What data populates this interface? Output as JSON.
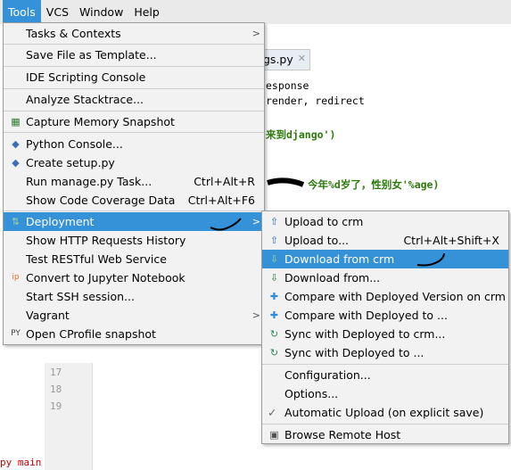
{
  "menubar": {
    "items": [
      "Tools",
      "VCS",
      "Window",
      "Help"
    ]
  },
  "editor": {
    "tab_label": "gs.py",
    "code_lines": [
      "esponse",
      "render, redirect",
      "来到django')",
      "今年%d岁了，性别女'%age)"
    ],
    "line_numbers": [
      "17",
      "18",
      "19"
    ],
    "bottom_cut_text": "py  main"
  },
  "tools_menu": {
    "tasks_contexts": "Tasks & Contexts",
    "save_template": "Save File as Template...",
    "ide_scripting": "IDE Scripting Console",
    "analyze_stacktrace": "Analyze Stacktrace...",
    "capture_memory": "Capture Memory Snapshot",
    "python_console": "Python Console...",
    "create_setup": "Create setup.py",
    "run_manage": "Run manage.py Task...",
    "run_manage_shortcut": "Ctrl+Alt+R",
    "show_coverage": "Show Code Coverage Data",
    "show_coverage_shortcut": "Ctrl+Alt+F6",
    "deployment": "Deployment",
    "http_history": "Show HTTP Requests History",
    "test_restful": "Test RESTful Web Service",
    "convert_jupyter": "Convert to Jupyter Notebook",
    "start_ssh": "Start SSH session...",
    "vagrant": "Vagrant",
    "open_cprofile": "Open CProfile snapshot"
  },
  "deployment_menu": {
    "upload_to_crm": "Upload to crm",
    "upload_to": "Upload to...",
    "upload_to_shortcut": "Ctrl+Alt+Shift+X",
    "download_from_crm": "Download from crm",
    "download_from": "Download from...",
    "compare_deployed_on_crm": "Compare with Deployed Version on crm",
    "compare_deployed_to": "Compare with Deployed to ...",
    "sync_crm": "Sync with Deployed to crm...",
    "sync_to": "Sync with Deployed to ...",
    "configuration": "Configuration...",
    "options": "Options...",
    "automatic_upload": "Automatic Upload (on explicit save)",
    "browse_remote": "Browse Remote Host"
  },
  "colors": {
    "selection": "#3592d8",
    "menu_bg": "#f2f2f2",
    "menubar_bg": "#eaeaea"
  }
}
